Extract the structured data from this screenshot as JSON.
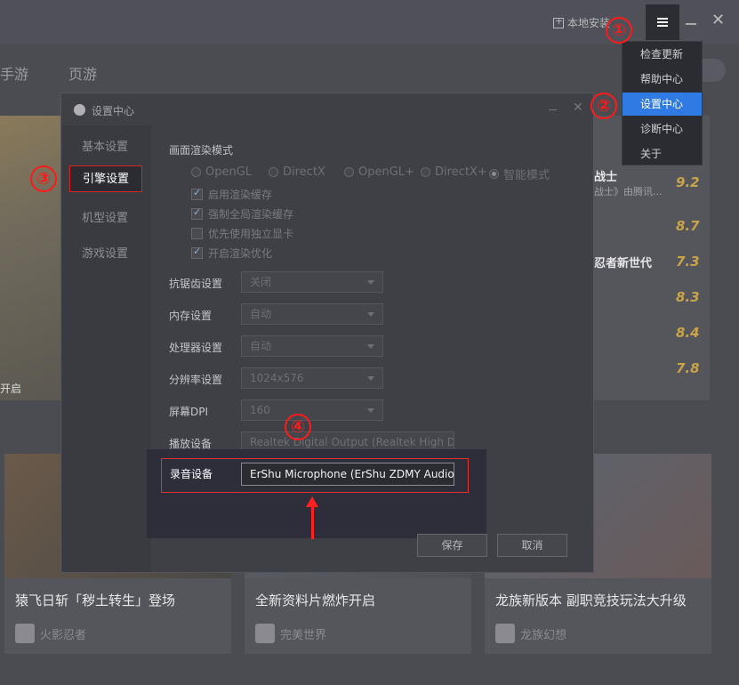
{
  "topbar": {
    "local_install": "本地安装"
  },
  "nav": {
    "tabs": [
      "手游",
      "页游"
    ]
  },
  "banner": {
    "text": "开启"
  },
  "menu": {
    "items": [
      {
        "label": "检查更新",
        "active": false
      },
      {
        "label": "帮助中心",
        "active": false
      },
      {
        "label": "设置中心",
        "active": true
      },
      {
        "label": "诊断中心",
        "active": false
      },
      {
        "label": "关于",
        "active": false
      }
    ]
  },
  "dialog": {
    "title": "设置中心",
    "sidebar": [
      "基本设置",
      "引擎设置",
      "机型设置",
      "游戏设置"
    ],
    "render_mode": {
      "label": "画面渲染模式",
      "options": [
        "OpenGL",
        "DirectX",
        "OpenGL+",
        "DirectX+",
        "智能模式"
      ],
      "selected": "智能模式"
    },
    "checks": [
      {
        "label": "启用渲染缓存",
        "checked": true
      },
      {
        "label": "强制全局渲染缓存",
        "checked": true
      },
      {
        "label": "优先使用独立显卡",
        "checked": false
      },
      {
        "label": "开启渲染优化",
        "checked": true
      }
    ],
    "fields": [
      {
        "label": "抗锯齿设置",
        "value": "关闭"
      },
      {
        "label": "内存设置",
        "value": "自动"
      },
      {
        "label": "处理器设置",
        "value": "自动"
      },
      {
        "label": "分辨率设置",
        "value": "1024x576"
      },
      {
        "label": "屏幕DPI",
        "value": "160"
      }
    ],
    "playback": {
      "label": "播放设备",
      "value": "Realtek Digital Output (Realtek High Def"
    },
    "record": {
      "label": "录音设备",
      "value": "ErShu Microphone (ErShu ZDMY Audio)"
    },
    "save": "保存",
    "cancel": "取消"
  },
  "ranking": [
    {
      "name": "战士",
      "sub": "战士》由腾讯...",
      "score": "9.2"
    },
    {
      "name": "",
      "sub": "",
      "score": "8.7"
    },
    {
      "name": "忍者新世代",
      "sub": "",
      "score": "7.3"
    },
    {
      "name": "",
      "sub": "",
      "score": "8.3"
    },
    {
      "name": "",
      "sub": "",
      "score": "8.4"
    },
    {
      "name": "",
      "sub": "",
      "score": "7.8"
    }
  ],
  "cards": [
    {
      "title": "猿飞日斩「秽土转生」登场",
      "game": "火影忍者"
    },
    {
      "title": "全新资料片燃炸开启",
      "game": "完美世界"
    },
    {
      "title": "龙族新版本 副职竞技玩法大升级",
      "game": "龙族幻想"
    }
  ],
  "annotations": [
    "①",
    "②",
    "③",
    "④"
  ]
}
